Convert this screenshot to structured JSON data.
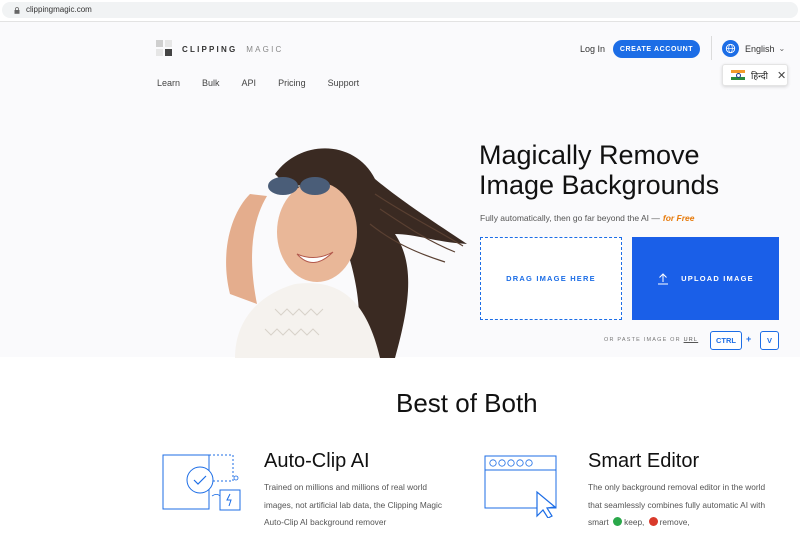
{
  "browser": {
    "url": "clippingmagic.com"
  },
  "logo": {
    "brand_bold": "CLIPPING",
    "brand_light": "MAGIC"
  },
  "nav": {
    "items": [
      "Learn",
      "Bulk",
      "API",
      "Pricing",
      "Support"
    ]
  },
  "header": {
    "login": "Log In",
    "create_account": "CREATE ACCOUNT",
    "language": "English",
    "translate_popup": "हिन्दी"
  },
  "hero": {
    "headline_line1": "Magically Remove",
    "headline_line2": "Image Backgrounds",
    "subtitle": "Fully automatically, then go far beyond the AI —",
    "subtitle_highlight": "for Free",
    "drag_label": "DRAG IMAGE HERE",
    "upload_label": "UPLOAD IMAGE",
    "paste_prefix": "OR PASTE IMAGE OR",
    "paste_url": "URL",
    "key_ctrl": "CTRL",
    "key_plus": "+",
    "key_v": "V"
  },
  "section": {
    "title": "Best of Both"
  },
  "features": [
    {
      "title": "Auto-Clip AI",
      "text": "Trained on millions and millions of real world images, not artificial lab data, the Clipping Magic Auto-Clip AI background remover"
    },
    {
      "title": "Smart Editor",
      "text_before": "The only background removal editor in the world that seamlessly combines fully automatic AI with smart",
      "keep": "keep,",
      "remove": "remove,"
    }
  ],
  "colors": {
    "accent": "#1c6de6",
    "upload_bg": "#1a5fe8",
    "highlight": "#e77b0c"
  }
}
